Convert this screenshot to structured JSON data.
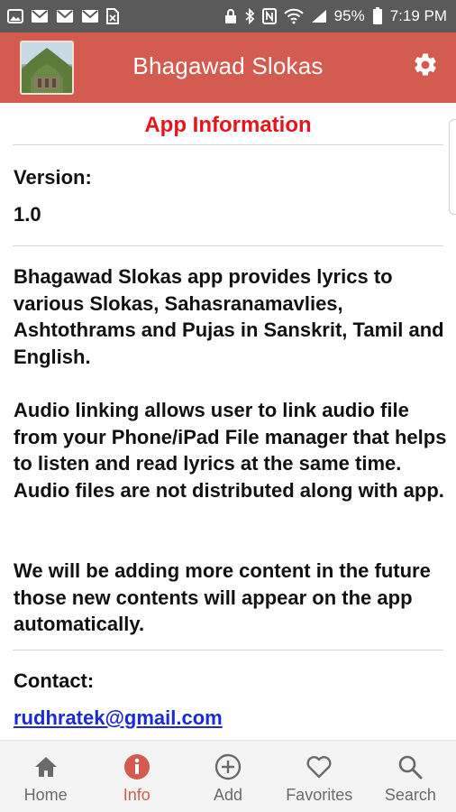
{
  "status_bar": {
    "battery_percent": "95%",
    "time": "7:19 PM",
    "left_icons": [
      "image-icon",
      "mail-icon",
      "mail-icon",
      "mail-icon",
      "sim-card-icon"
    ],
    "right_icons": [
      "lock-icon",
      "bluetooth-icon",
      "nfc-icon",
      "wifi-icon",
      "signal-icon",
      "battery-icon"
    ]
  },
  "app_bar": {
    "title": "Bhagawad Slokas",
    "color": "#d45b4f",
    "logo_icon": "temple-logo",
    "settings_icon": "gear-icon"
  },
  "info": {
    "heading": "App Information",
    "heading_color": "#e8141b",
    "version_label": "Version:",
    "version_value": "1.0",
    "paragraphs": [
      "Bhagawad Slokas app provides lyrics to various Slokas, Sahasranamavlies, Ashtothrams and Pujas in Sanskrit, Tamil and English.",
      "Audio linking allows user to link audio file from your Phone/iPad File manager that helps to listen and read lyrics at the same time.  Audio files are not distributed along with app.",
      "We will be adding more content in the future those new contents will appear on the app automatically."
    ],
    "contact_label": "Contact:",
    "contact_email": "rudhratek@gmail.com"
  },
  "bottom_nav": {
    "items": [
      {
        "label": "Home",
        "icon": "home-icon",
        "active": false
      },
      {
        "label": "Info",
        "icon": "info-icon",
        "active": true
      },
      {
        "label": "Add",
        "icon": "add-circle-icon",
        "active": false
      },
      {
        "label": "Favorites",
        "icon": "heart-icon",
        "active": false
      },
      {
        "label": "Search",
        "icon": "search-icon",
        "active": false
      }
    ],
    "active_color": "#d45b4f"
  }
}
